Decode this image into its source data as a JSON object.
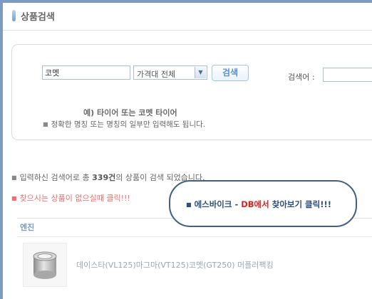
{
  "header": {
    "title": "상품검색"
  },
  "search": {
    "keyword_value": "코멧",
    "price_select": "가격대 전체",
    "search_button": "검색",
    "keyword_label": "검색어 :",
    "example": "예) 타이어 또는 코멧 타이어",
    "hint": "정확한 명칭 또는 명칭의 일부만 입력해도 됩니다."
  },
  "results": {
    "prefix": "입력하신 검색어로 총",
    "count": "339건",
    "suffix": "의 상품이 검색 되었습니다.",
    "not_found": "찾으시는 상품이 없으실때 클릭!!!"
  },
  "callout": {
    "part1": "에스바이크 - ",
    "db": "DB에서",
    "part2": " 찾아보기 클릭!!!"
  },
  "category": {
    "label": "엔진"
  },
  "products": [
    {
      "name": "데이스타(VL125)마그마(VT125)코멧(GT250) 머플러팩킹"
    }
  ],
  "colors": {
    "accent": "#5a8fd0",
    "link_red": "#f36d6d",
    "callout_border": "#3f6087",
    "db_red": "#e02020"
  }
}
